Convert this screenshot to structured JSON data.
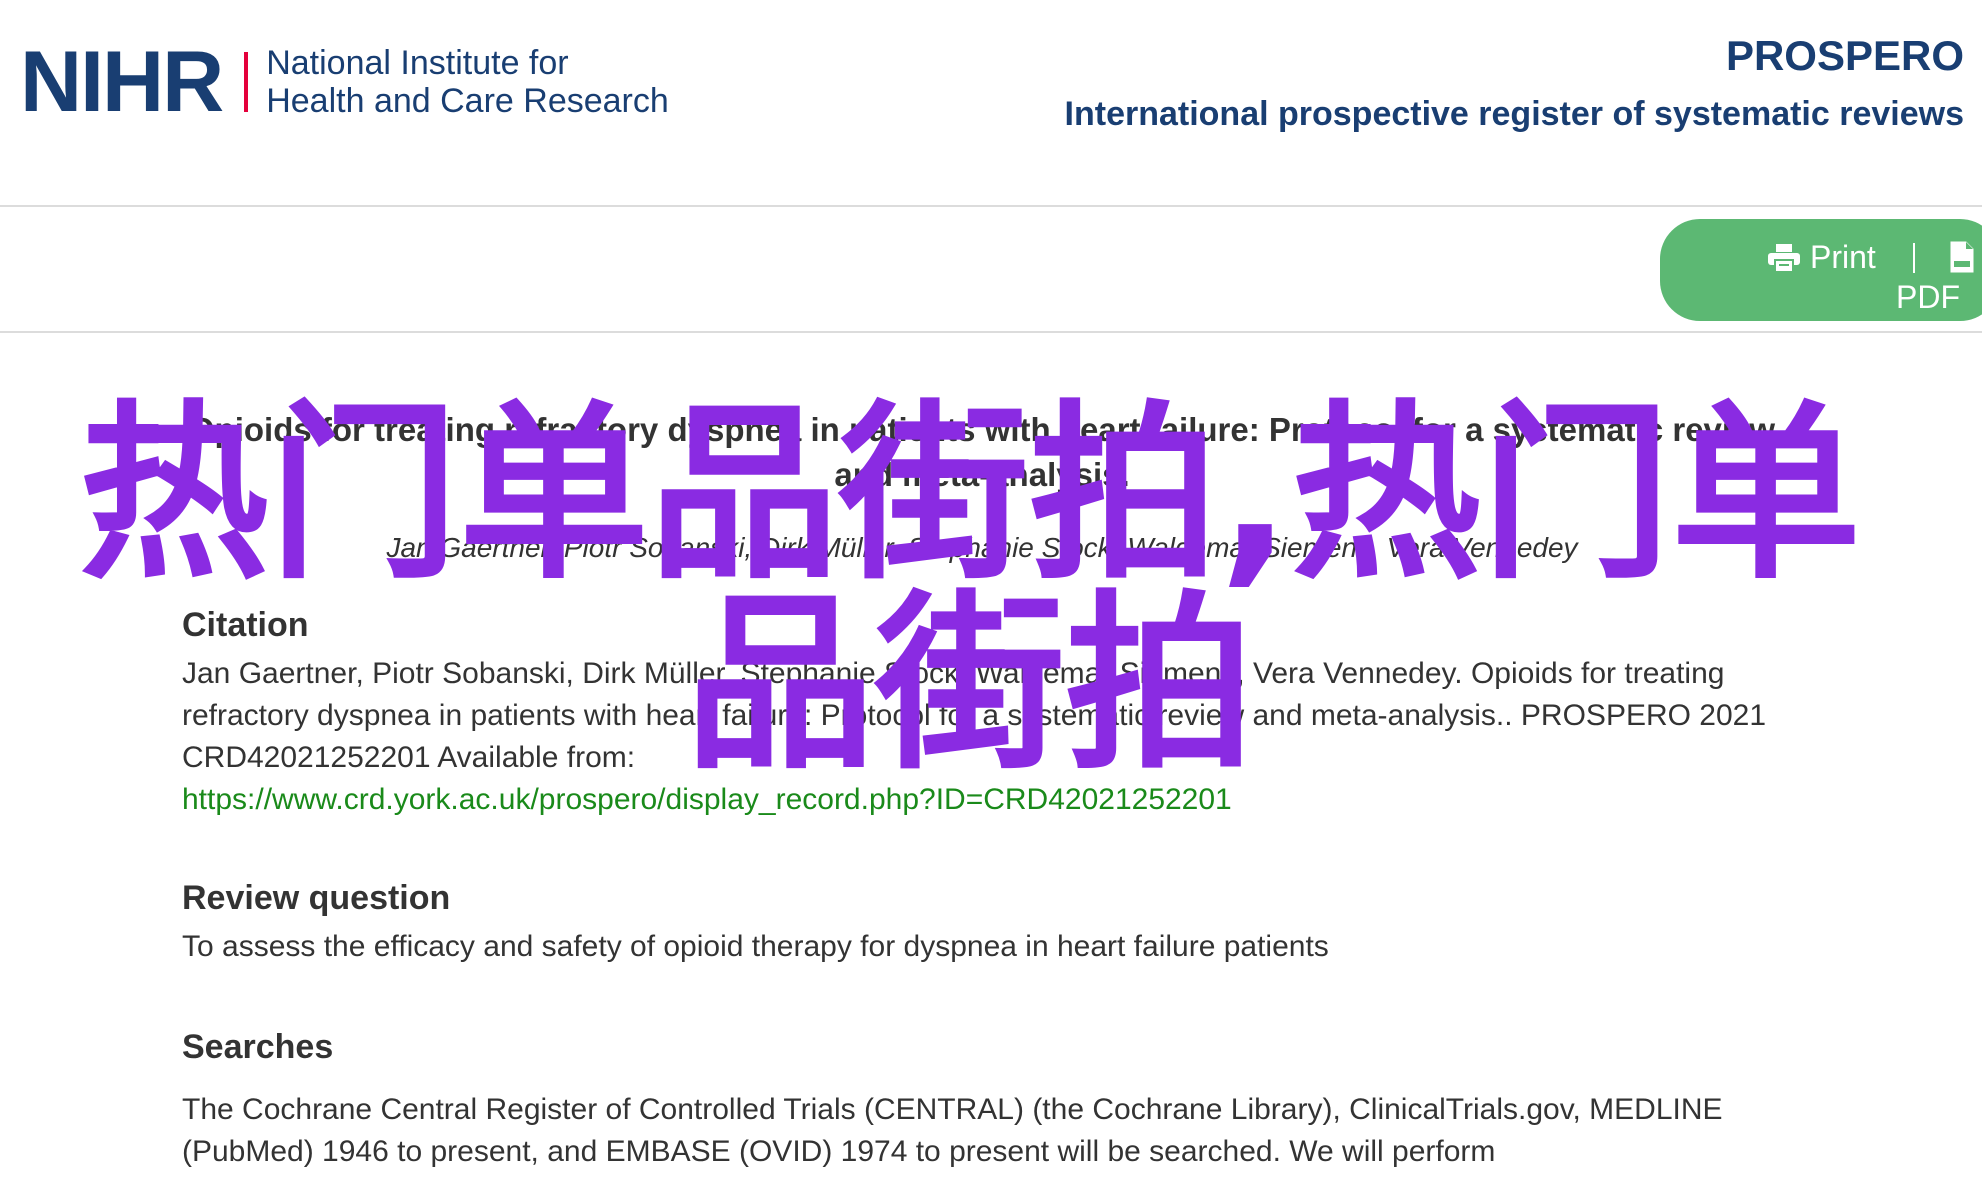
{
  "header": {
    "org_logo_mark": "NIHR",
    "org_name_line1": "National Institute for",
    "org_name_line2": "Health and Care Research",
    "app_title": "PROSPERO",
    "app_subtitle": "International prospective register of systematic reviews"
  },
  "toolbar": {
    "print_label": "Print",
    "pdf_label": "PDF",
    "print_icon": "printer-icon",
    "pdf_icon": "pdf-file-icon",
    "accent_color": "#5cb873"
  },
  "record": {
    "title": "Opioids for treating refractory dyspnea in patients with heart failure: Protocol for a systematic review and meta-analysis.",
    "authors": "Jan Gaertner, Piotr Sobanski, Dirk Müller, Stephanie Stock, Waldemar Siemens, Vera Vennedey"
  },
  "citation": {
    "heading": "Citation",
    "text": "Jan Gaertner, Piotr Sobanski, Dirk Müller, Stephanie Stock, Waldemar Siemens, Vera Vennedey. Opioids for treating refractory dyspnea in patients with heart failure: Protocol for a systematic review and meta-analysis.. PROSPERO 2021 CRD42021252201 Available from:",
    "link": "https://www.crd.york.ac.uk/prospero/display_record.php?ID=CRD42021252201"
  },
  "review_question": {
    "heading": "Review question",
    "text": "To assess the efficacy and safety of opioid therapy for dyspnea in heart failure patients"
  },
  "searches": {
    "heading": "Searches",
    "text": "The Cochrane Central Register of Controlled Trials (CENTRAL) (the Cochrane Library), ClinicalTrials.gov, MEDLINE (PubMed) 1946 to present, and EMBASE (OVID) 1974 to present will be searched. We will perform"
  },
  "watermark": {
    "text": "热门单品街拍,热门单品街拍",
    "color": "#8a2be2"
  },
  "colors": {
    "brand_navy": "#193e72",
    "brand_red": "#e4003b",
    "link_green": "#1a8a1a"
  }
}
